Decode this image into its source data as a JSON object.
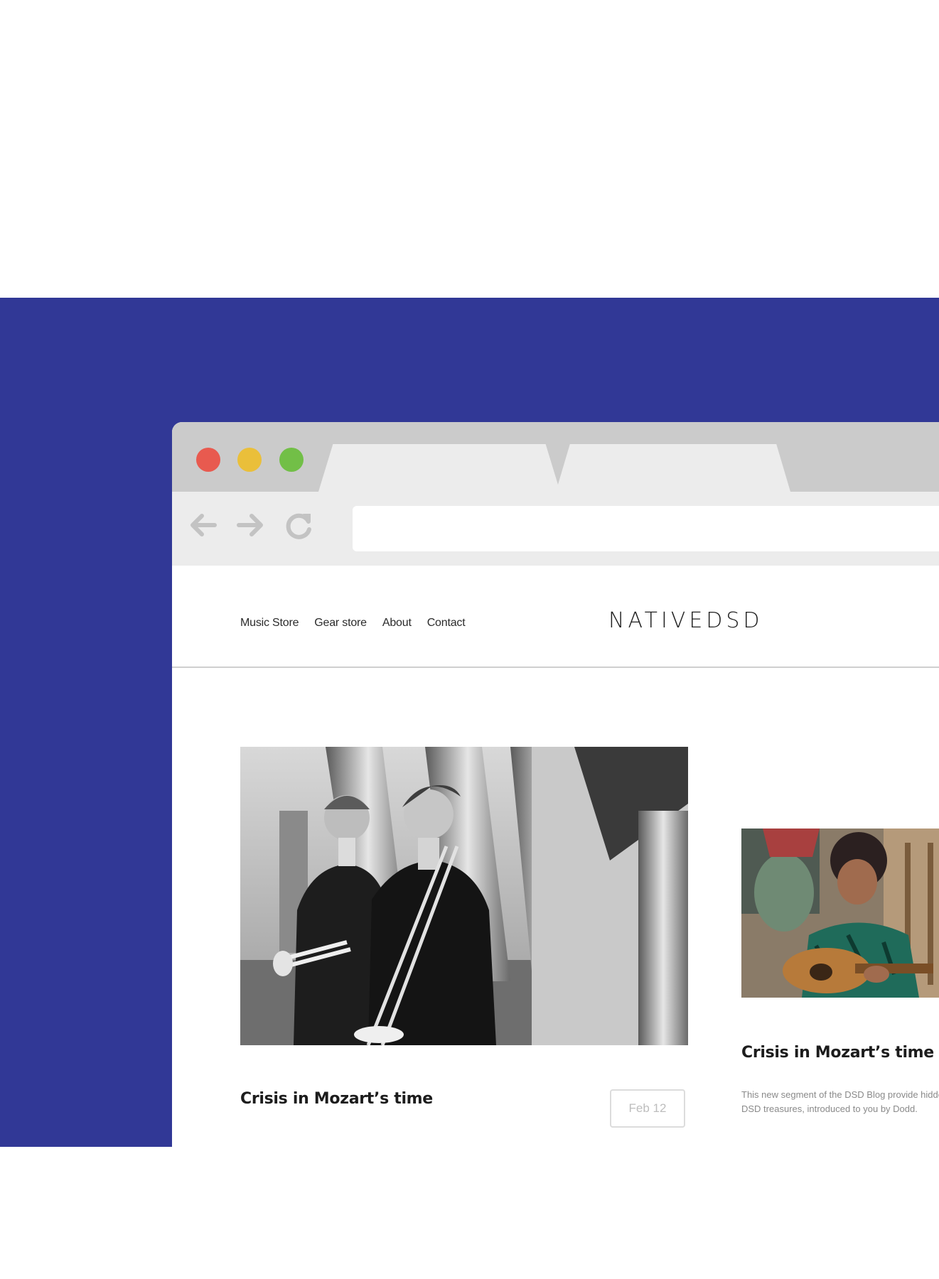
{
  "browser": {
    "tabs": [
      "",
      ""
    ],
    "url": ""
  },
  "site": {
    "nav": [
      "Music Store",
      "Gear store",
      "About",
      "Contact"
    ],
    "logo": "NATIVEDSD"
  },
  "hero_post": {
    "title": "Crisis in Mozart’s time",
    "date": "Feb 12"
  },
  "side_post": {
    "title": "Crisis in Mozart’s time",
    "excerpt": "This new segment of the DSD Blog provide hidden DSD treasures, introduced to you by Dodd."
  },
  "colors": {
    "background_band": "#313896",
    "close_dot": "#e85a4f",
    "minimize_dot": "#eabf3a",
    "maximize_dot": "#72bf47"
  },
  "icons": [
    "back-arrow-icon",
    "forward-arrow-icon",
    "reload-icon"
  ]
}
